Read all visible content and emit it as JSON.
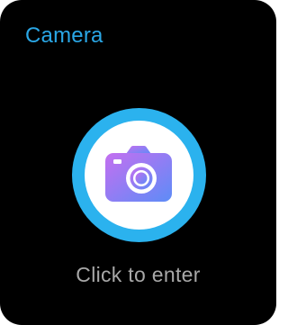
{
  "app": {
    "title": "Camera"
  },
  "launcher": {
    "icon": "camera-icon",
    "caption": "Click to enter"
  },
  "colors": {
    "background": "#000000",
    "accent": "#2aa7e6",
    "ring": "#2bb2ee",
    "caption": "#a8a8a8",
    "icon_gradient_start": "#c46ff0",
    "icon_gradient_end": "#5d8cf7"
  }
}
